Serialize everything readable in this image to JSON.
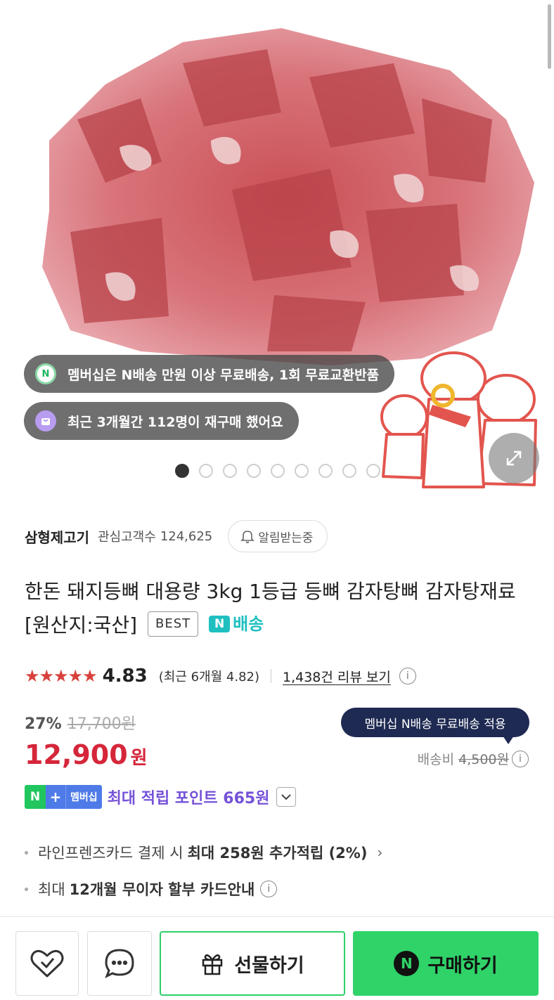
{
  "hero": {
    "membership_pill": "멤버십은 N배송 만원 이상 무료배송, 1회 무료교환반품",
    "membership_icon_text": "N",
    "repurchase_pill": "최근 3개월간 112명이 재구매 했어요",
    "slide_count": 9,
    "active_slide": 1
  },
  "store": {
    "name": "삼형제고기",
    "fans_label": "관심고객수",
    "fans_count": "124,625",
    "alarm_label": "알림받는중"
  },
  "product": {
    "title": "한돈 돼지등뼈 대용량 3kg 1등급 등뼈 감자탕뼈 감자탕재료 [원산지:국산]",
    "best_badge": "BEST",
    "delivery_badge_n": "N",
    "delivery_badge_text": "배송"
  },
  "rating": {
    "stars": "★★★★★",
    "value": "4.83",
    "recent": "(최근 6개월 4.82)",
    "review_link": "1,438건 리뷰 보기",
    "info_icon": "i"
  },
  "price": {
    "discount": "27%",
    "original": "17,700원",
    "sale_number": "12,900",
    "sale_unit": "원",
    "tooltip": "멤버십 N배송 무료배송 적용",
    "shipping_label": "배송비",
    "shipping_fee": "4,500원",
    "points_badge_n": "N",
    "points_badge_plus": "+",
    "points_badge_label": "멤버십",
    "points_text": "최대 적립 포인트 665원"
  },
  "benefits": {
    "card_prefix": "라인프렌즈카드 결제 시",
    "card_bold": "최대 258원 추가적립 (2%)",
    "installment_prefix": "최대",
    "installment_bold": "12개월 무이자 할부 카드안내"
  },
  "bottom_bar": {
    "gift_label": "선물하기",
    "buy_logo": "N",
    "buy_label": "구매하기"
  },
  "colors": {
    "accent_green": "#2fd368",
    "price_red": "#d5263a",
    "points_purple": "#7552d8",
    "tooltip_navy": "#1e2a52"
  }
}
